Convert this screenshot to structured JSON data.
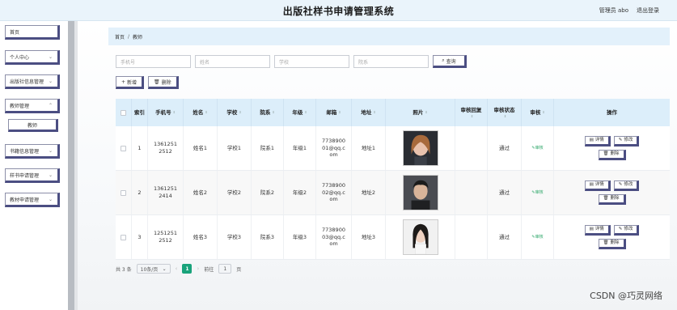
{
  "header": {
    "title": "出版社样书申请管理系统",
    "user_label": "管理员 abo",
    "logout_label": "退出登录"
  },
  "sidebar": {
    "items": [
      {
        "label": "首页"
      },
      {
        "label": "个人中心"
      },
      {
        "label": "出版社信息管理"
      },
      {
        "label": "教师管理"
      },
      {
        "label": "教师"
      },
      {
        "label": "书籍信息管理"
      },
      {
        "label": "样书申请管理"
      },
      {
        "label": "教材申请管理"
      }
    ]
  },
  "breadcrumb": {
    "home": "首页",
    "sep": "/",
    "current": "教师"
  },
  "search": {
    "phone_placeholder": "手机号",
    "name_placeholder": "姓名",
    "school_placeholder": "学校",
    "dept_placeholder": "院系",
    "query_label": "查询"
  },
  "actions": {
    "add_label": "新增",
    "delete_label": "删除"
  },
  "table": {
    "headers": {
      "index": "索引",
      "phone": "手机号",
      "name": "姓名",
      "school": "学校",
      "dept": "院系",
      "grade": "年级",
      "email": "邮箱",
      "address": "地址",
      "photo": "照片",
      "reply": "审核回复",
      "status": "审核状态",
      "audit": "审核",
      "ops": "操作"
    },
    "rows": [
      {
        "index": "1",
        "phone": "1361251 2512",
        "name": "姓名1",
        "school": "学校1",
        "dept": "院系1",
        "grade": "年级1",
        "email": "7738900 01@qq.c om",
        "address": "地址1",
        "status": "通过",
        "audit": "审核"
      },
      {
        "index": "2",
        "phone": "1361251 2414",
        "name": "姓名2",
        "school": "学校2",
        "dept": "院系2",
        "grade": "年级2",
        "email": "7738900 02@qq.c om",
        "address": "地址2",
        "status": "通过",
        "audit": "审核"
      },
      {
        "index": "3",
        "phone": "1251251 2512",
        "name": "姓名3",
        "school": "学校3",
        "dept": "院系3",
        "grade": "年级3",
        "email": "7738900 03@qq.c om",
        "address": "地址3",
        "status": "通过",
        "audit": "审核"
      }
    ],
    "ops": {
      "detail": "详情",
      "edit": "修改",
      "delete": "删除"
    }
  },
  "pager": {
    "total": "共 3 条",
    "page_size": "10条/页",
    "current": "1",
    "goto": "前往",
    "goto_value": "1",
    "page_unit": "页"
  },
  "watermark": "CSDN @巧灵网络"
}
